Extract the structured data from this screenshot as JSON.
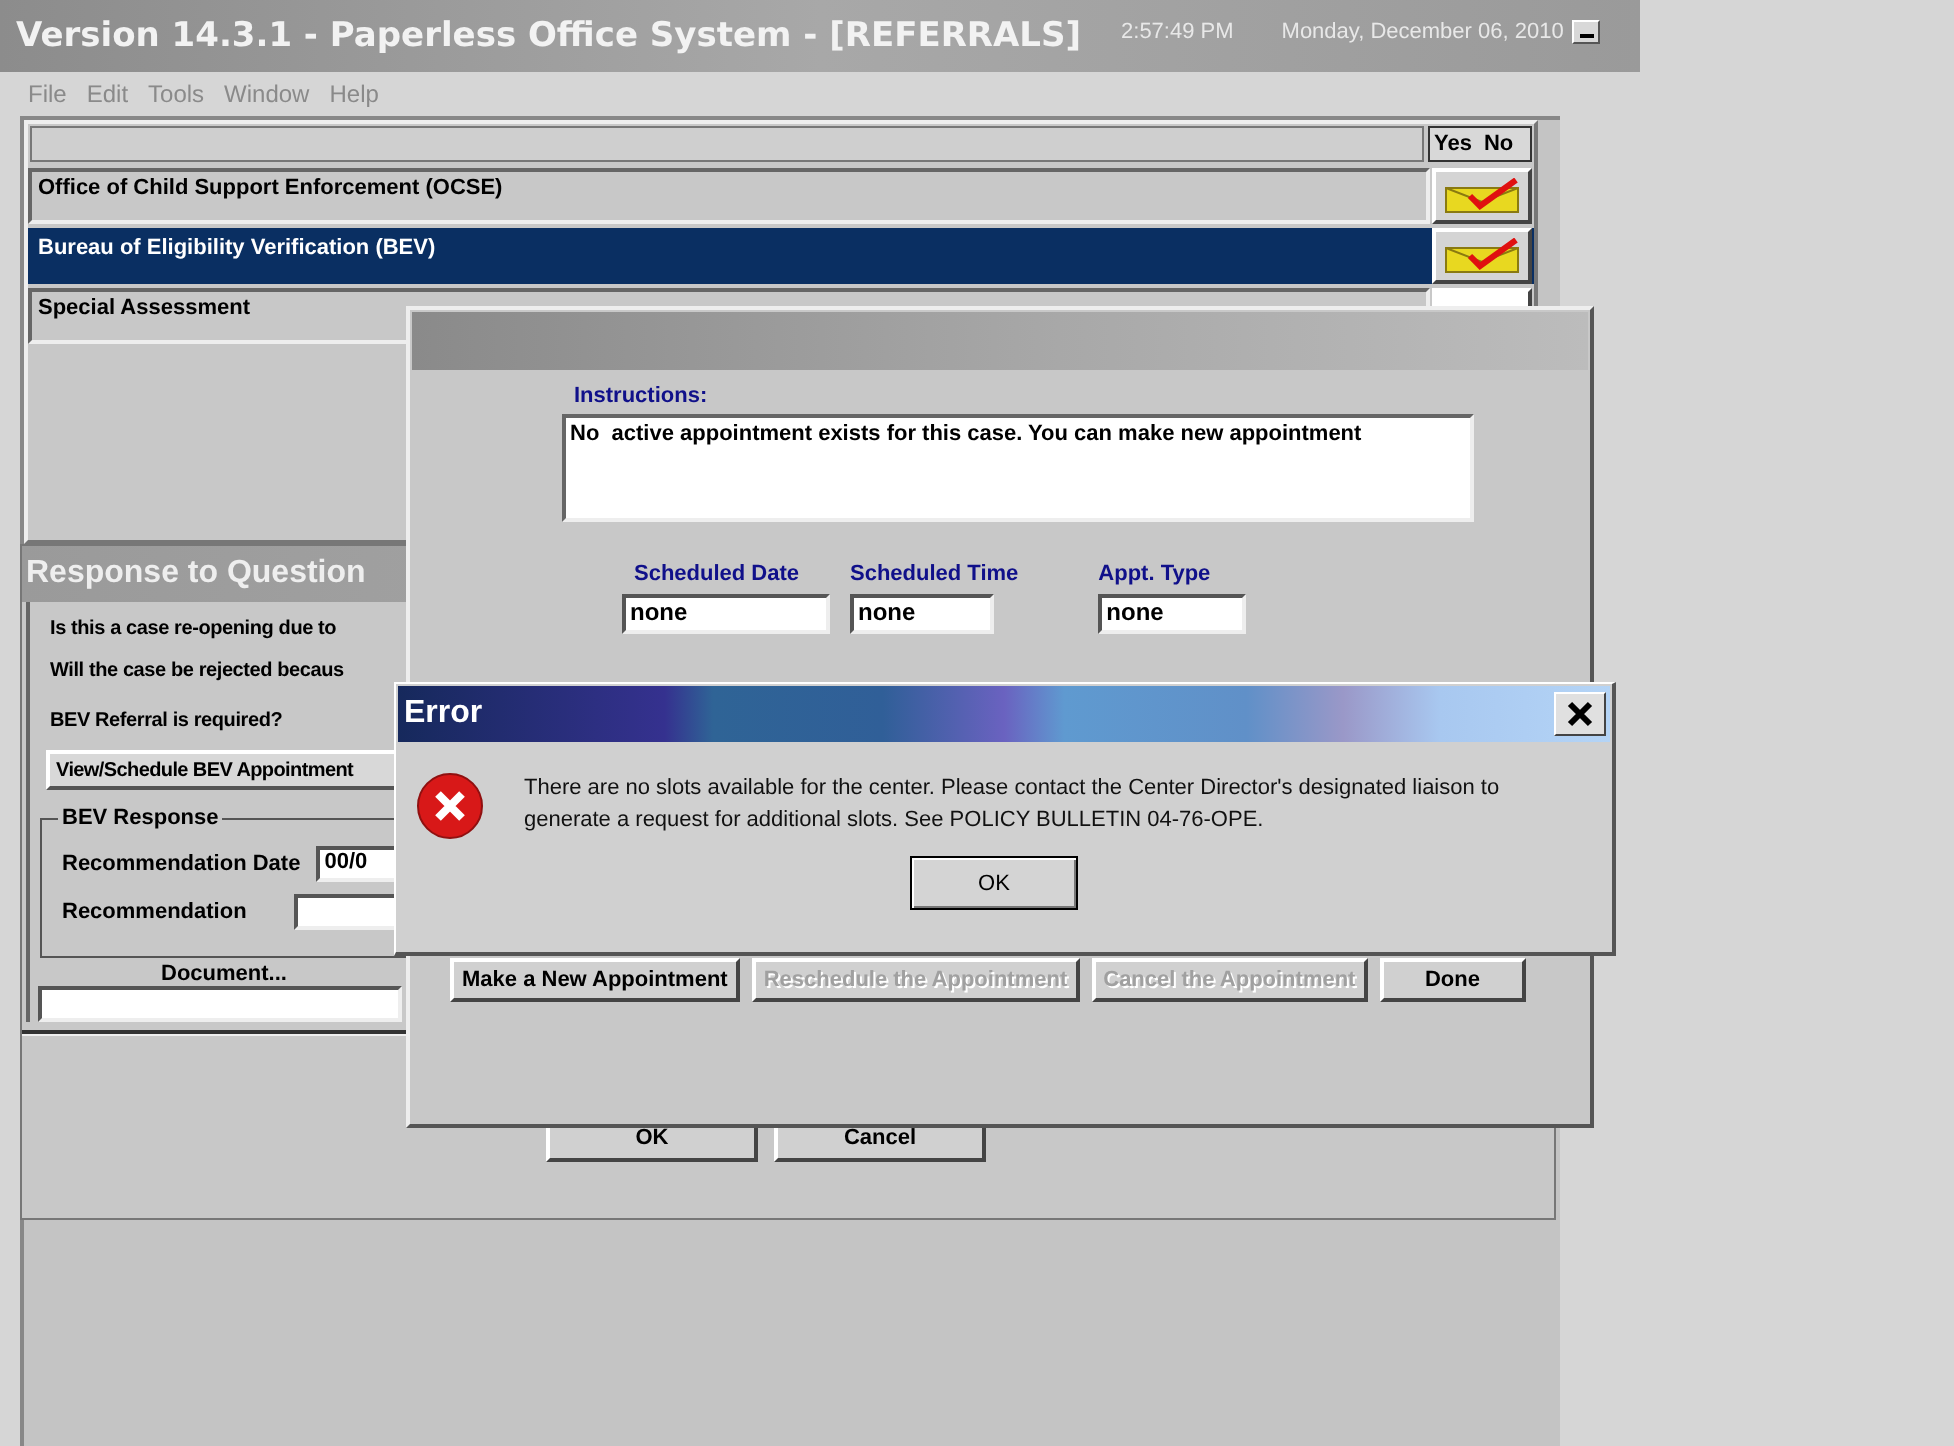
{
  "window": {
    "title": "Version 14.3.1 - Paperless Office System - [REFERRALS]",
    "time": "2:57:49 PM",
    "date": "Monday, December 06, 2010"
  },
  "menu": [
    "File",
    "Edit",
    "Tools",
    "Window",
    "Help"
  ],
  "referrals": {
    "columns": [
      "Yes",
      "No"
    ],
    "rows": [
      {
        "name": "Office of Child Support Enforcement (OCSE)",
        "selected": false,
        "checked": true
      },
      {
        "name": "Bureau of Eligibility Verification (BEV)",
        "selected": true,
        "checked": true
      },
      {
        "name": "Special Assessment",
        "selected": false,
        "checked": false
      }
    ]
  },
  "response": {
    "title": "Response to Question",
    "questions": [
      "Is this a case re-opening due to",
      "Will the case be rejected becaus"
    ],
    "referral_label": "BEV Referral is required?",
    "schedule_button": "View/Schedule BEV Appointment",
    "group": {
      "title": "BEV Response",
      "date_label": "Recommendation Date",
      "date_value": "00/0",
      "recommendation_label": "Recommendation"
    },
    "document_label": "Document...",
    "buttons": [
      "OK",
      "Cancel"
    ]
  },
  "appointment": {
    "instructions_label": "Instructions:",
    "instructions": "No  active appointment exists for this case. You can make new appointment",
    "fields": [
      {
        "label": "Scheduled Date",
        "value": "none"
      },
      {
        "label": "Scheduled Time",
        "value": "none"
      },
      {
        "label": "Appt. Type",
        "value": "none"
      }
    ],
    "buttons": [
      {
        "label": "Make a New Appointment",
        "disabled": false
      },
      {
        "label": "Reschedule the Appointment",
        "disabled": true
      },
      {
        "label": "Cancel the Appointment",
        "disabled": true
      },
      {
        "label": "Done",
        "disabled": false
      }
    ]
  },
  "error": {
    "title": "Error",
    "message": "There are no slots available for the center. Please contact the Center Director's designated liaison to generate a request for additional slots. See POLICY BULLETIN 04-76-OPE.",
    "button": "OK"
  }
}
